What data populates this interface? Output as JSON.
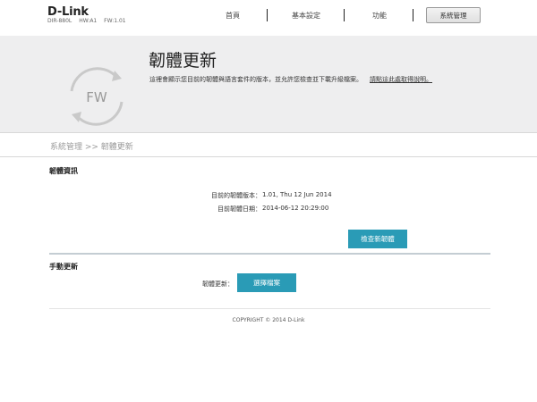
{
  "header": {
    "logo": "D-Link",
    "model": "DIR-880L",
    "hw": "HW:A1",
    "fw": "FW:1.01"
  },
  "nav": {
    "home": "首頁",
    "basic": "基本設定",
    "features": "功能",
    "management": "系統管理"
  },
  "banner": {
    "icon_text": "FW",
    "title": "韌體更新",
    "description": "這裡會顯示您目前的韌體與語言套件的版本，並允許您檢查並下載升級檔案。",
    "link": "請點這此處取得說明。"
  },
  "breadcrumb": "系統管理 >> 韌體更新",
  "firmware_info": {
    "title": "韌體資訊",
    "version_label": "目前的韌體版本：",
    "version_value": "1.01, Thu 12 Jun 2014",
    "date_label": "目前韌體日期：",
    "date_value": "2014-06-12 20:29:00",
    "check_button": "檢查新韌體"
  },
  "manual_update": {
    "title": "手動更新",
    "field_label": "韌體更新：",
    "select_button": "選擇檔案"
  },
  "footer": "COPYRIGHT © 2014 D-Link",
  "colors": {
    "accent": "#2a9bb6",
    "banner_bg": "#eeeeef",
    "divider": "#c4cdd3"
  }
}
